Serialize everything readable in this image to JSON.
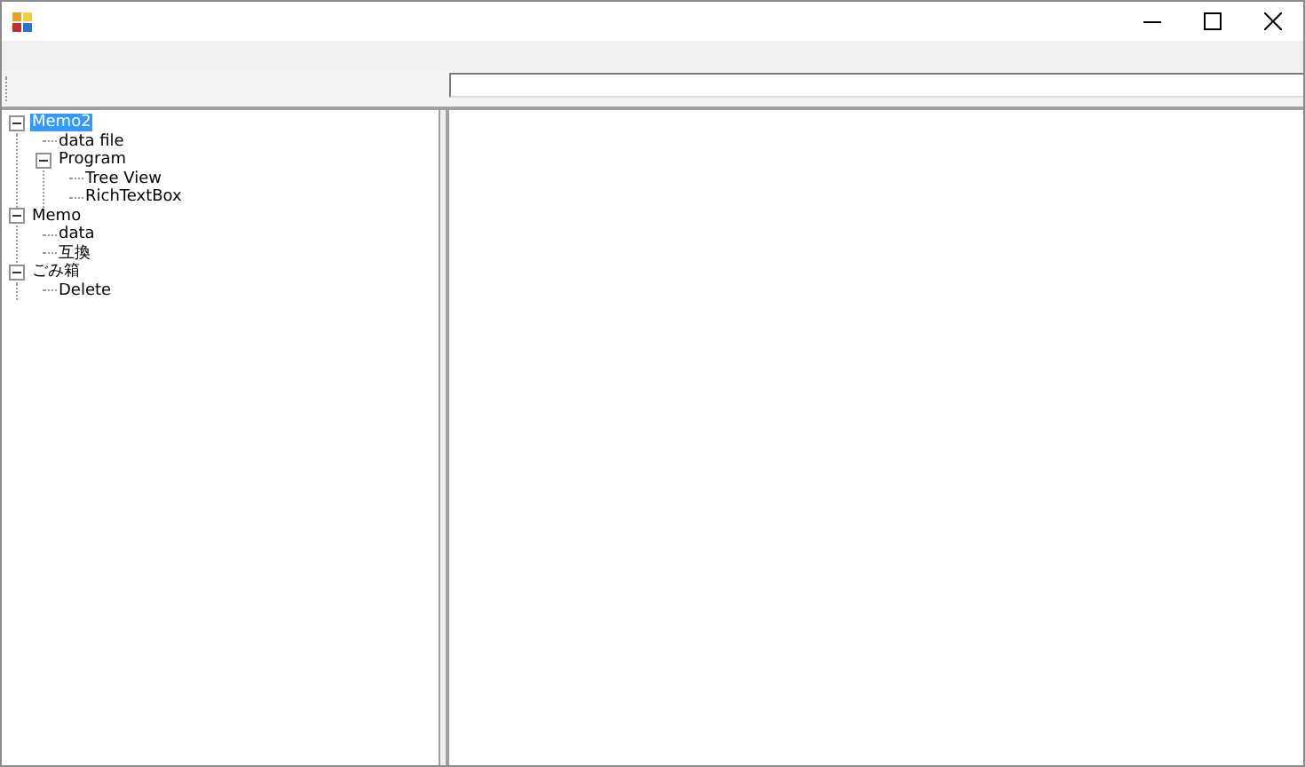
{
  "tree": [
    {
      "label": "Memo2",
      "selected": true,
      "expanded": true,
      "children": [
        {
          "label": "data file",
          "selected": false
        },
        {
          "label": "Program",
          "selected": false,
          "expanded": true,
          "children": [
            {
              "label": "Tree View",
              "selected": false
            },
            {
              "label": "RichTextBox",
              "selected": false
            }
          ]
        }
      ]
    },
    {
      "label": "Memo",
      "selected": false,
      "expanded": true,
      "children": [
        {
          "label": "data",
          "selected": false
        },
        {
          "label": "互換",
          "selected": false
        }
      ]
    },
    {
      "label": "ごみ箱",
      "selected": false,
      "expanded": true,
      "children": [
        {
          "label": "Delete",
          "selected": false
        }
      ]
    }
  ]
}
